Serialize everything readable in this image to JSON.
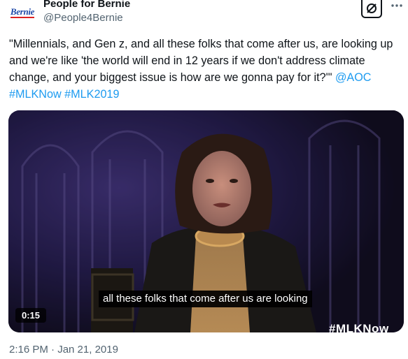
{
  "author": {
    "avatar_text": "Bernie",
    "name": "People for Bernie",
    "handle": "@People4Bernie"
  },
  "icons": {
    "grok": "grok-icon",
    "more": "more-horizontal-icon"
  },
  "tweet": {
    "quote_text": "\"Millennials, and Gen z, and all these folks that come after us, are looking up and we're like 'the world will end in 12 years if we don't address climate change, and your biggest issue is how are we gonna pay for it?'\"",
    "mention": "@AOC",
    "hashtag_1": "#MLKNow",
    "hashtag_2": "#MLK2019"
  },
  "video": {
    "subtitle": "all these folks that come after us are looking",
    "duration": "0:15",
    "watermark": "#MLKNow"
  },
  "timestamp": "2:16 PM · Jan 21, 2019",
  "colors": {
    "link": "#1d9bf0",
    "text": "#0f1419",
    "secondary": "#536471"
  }
}
